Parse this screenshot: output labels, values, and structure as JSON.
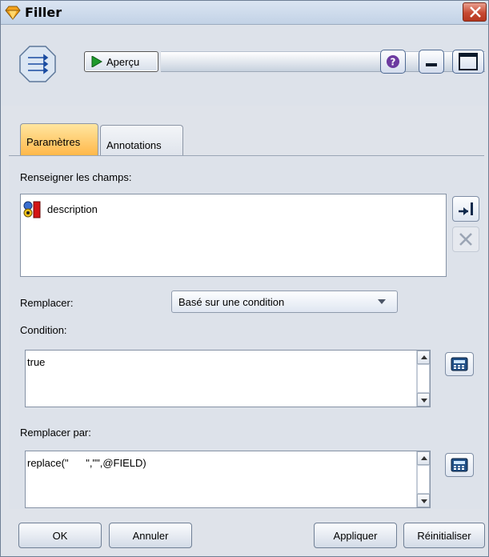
{
  "window": {
    "title": "Filler"
  },
  "toolbar": {
    "preview_label": "Aperçu",
    "help_icon": "help-icon",
    "minimize_icon": "minimize-icon",
    "maximize_icon": "maximize-icon"
  },
  "tabs": [
    {
      "label": "Paramètres",
      "active": true
    },
    {
      "label": "Annotations",
      "active": false
    }
  ],
  "fields_section": {
    "label": "Renseigner les champs:",
    "items": [
      {
        "label": "description"
      }
    ]
  },
  "replace": {
    "label": "Remplacer:",
    "selected": "Basé sur une condition"
  },
  "condition": {
    "label": "Condition:",
    "value": "true"
  },
  "replace_with": {
    "label": "Remplacer par:",
    "value": "replace(\"      \",\"\",@FIELD)"
  },
  "buttons": {
    "ok": "OK",
    "cancel": "Annuler",
    "apply": "Appliquer",
    "reset": "Réinitialiser"
  },
  "colors": {
    "active_tab": "#ffb84a",
    "close_button": "#c74a33",
    "window_bg": "#dfe3ea"
  }
}
